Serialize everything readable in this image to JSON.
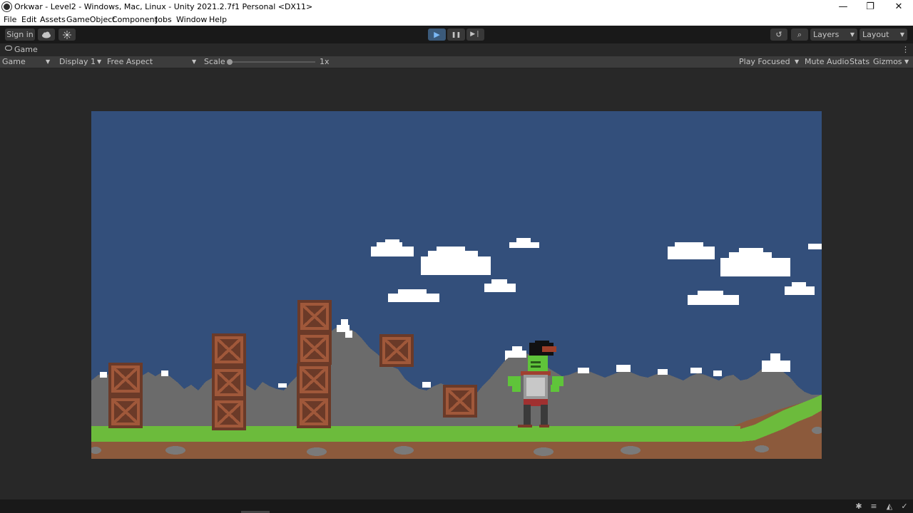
{
  "window": {
    "title": "Orkwar - Level2 - Windows, Mac, Linux - Unity 2021.2.7f1 Personal <DX11>",
    "minimize": "—",
    "maximize": "❐",
    "close": "✕"
  },
  "menu": [
    "File",
    "Edit",
    "Assets",
    "GameObject",
    "Component",
    "Jobs",
    "Window",
    "Help"
  ],
  "toolbar": {
    "sign_in": "Sign in",
    "play": "▶",
    "pause": "❚❚",
    "step": "▶❘",
    "history": "↺",
    "search": "⌕",
    "layers": "Layers",
    "layout": "Layout"
  },
  "tab": {
    "label": "Game",
    "more": "⋮"
  },
  "gamebar": {
    "view": "Game",
    "display": "Display 1",
    "aspect": "Free Aspect",
    "scale_label": "Scale",
    "scale_value": "1x",
    "scale_fraction": 0.0,
    "play_focused": "Play Focused",
    "mute_audio": "Mute Audio",
    "stats": "Stats",
    "gizmos": "Gizmos"
  },
  "colors": {
    "sky": "#334f7b",
    "mountain": "#6b6b6b",
    "grass": "#6cbb3c",
    "dirt": "#8c5a3c",
    "crate": "#6b3a28",
    "crate_inner": "#a0583a",
    "cloud": "#ffffff",
    "orc_skin": "#5fc43a"
  }
}
